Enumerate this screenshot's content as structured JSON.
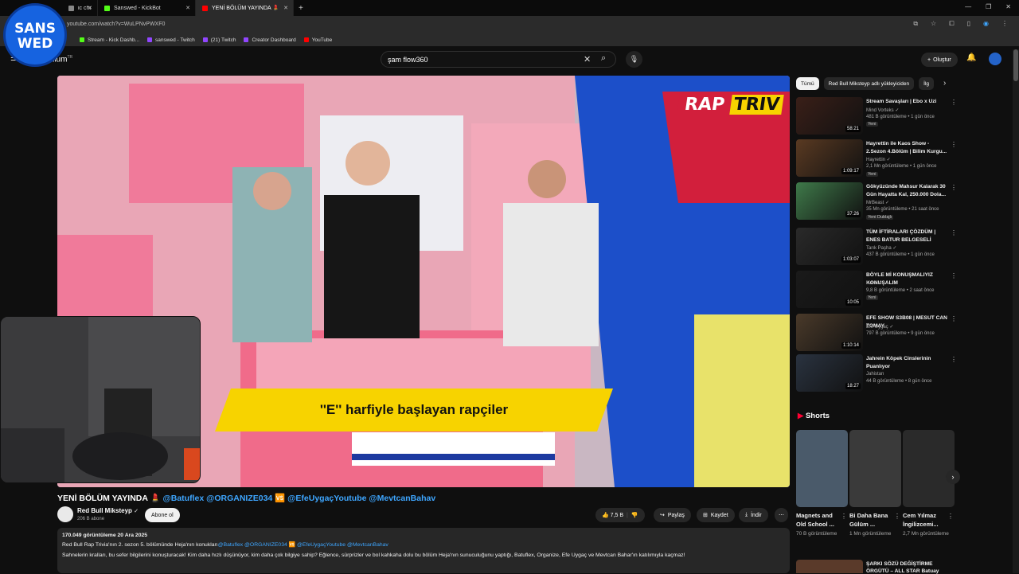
{
  "browser": {
    "tabs": [
      {
        "title": "ic charts: Nigeria",
        "color": "#888888"
      },
      {
        "title": "Sanswed - KickBot",
        "color": "#53fc18"
      },
      {
        "title": "YENİ BÖLÜM YAYINDA 💄",
        "color": "#ff0000",
        "active": true
      }
    ],
    "url": "youtube.com/watch?v=WuLPNvPWXF0",
    "bookmarks": [
      {
        "label": "Stream - Kick Dashb...",
        "color": "#53fc18"
      },
      {
        "label": "sanswed - Twitch",
        "color": "#9146ff"
      },
      {
        "label": "(21) Twitch",
        "color": "#9146ff"
      },
      {
        "label": "Creator Dashboard",
        "color": "#9146ff"
      },
      {
        "label": "YouTube",
        "color": "#ff0000"
      }
    ]
  },
  "overlay_logo": {
    "line1": "SANS",
    "line2": "WED"
  },
  "youtube": {
    "brand": "mium",
    "brand_suffix": "TR",
    "search_value": "şam flow360",
    "create_label": "Oluştur"
  },
  "video": {
    "caption": "''E'' harfiyle başlayan rapçiler",
    "title": "YENİ BÖLÜM YAYINDA 💄 ",
    "title_tags": "@Batuflex @ORGANIZE034 🆚 @EfeUygaçYoutube @MevtcanBahav",
    "channel": "Red Bull Miksteyp",
    "subscribers": "206 B abone",
    "subscribe_label": "Abone ol",
    "likes": "7,5 B",
    "share_label": "Paylaş",
    "save_label": "Kaydet",
    "download_label": "İndir",
    "views_date": "170.049 görüntüleme  20 Ara 2025",
    "desc_line1": "Red Bull Rap Trivia'nın 2. sezon 5. bölümünde Heja'nın konukları",
    "desc_line1_tags": "@Batuflex @ORGANIZE034 🆚 @EfeUygaçYoutube @MevtcanBahav",
    "desc_line2": "Sahnelerin kralları, bu sefer bilgilerini konuşturacak! Kim daha hızlı düşünüyor, kim daha çok bilgiye sahip? Eğlence, sürprizler ve bol kahkaha dolu bu bölüm Heja'nın sunuculuğunu yaptığı, Batuflex, Organize, Efe Uygaç ve Mevtcan Bahar'ın katılımıyla kaçmaz!"
  },
  "chips": [
    "Tümü",
    "Red Bull Miksteyp adlı yükleyiciden",
    "İlg"
  ],
  "recommendations": [
    {
      "title": "Stream Savaşları | Ebo x Uzi",
      "channel": "Mind Vorteks ✓",
      "meta": "481 B görüntüleme • 1 gün önce",
      "badge": "Yeni",
      "duration": "58:21",
      "color": "#3a1f18"
    },
    {
      "title": "Hayrettin ile Kaos Show - 2.Sezon 4.Bölüm | Bilim Kurgu...",
      "channel": "Hayrettin ✓",
      "meta": "2,1 Mn görüntüleme • 1 gün önce",
      "badge": "Yeni",
      "duration": "1:09:17",
      "color": "#5a3a22"
    },
    {
      "title": "Gökyüzünde Mahsur Kalarak 30 Gün Hayatta Kal, 250.000 Dola...",
      "channel": "MrBeast ✓",
      "meta": "35 Mn görüntüleme • 21 saat önce",
      "badge": "Yeni  Dublajlı",
      "duration": "37:26",
      "color": "#3f7a4a"
    },
    {
      "title": "TÜM İFTİRALARI ÇÖZDÜM | ENES BATUR BELGESELİ",
      "channel": "Tarık Paşha ✓",
      "meta": "437 B görüntüleme • 1 gün önce",
      "badge": "",
      "duration": "1:03:07",
      "color": "#2a2a2a"
    },
    {
      "title": "BÖYLE Mİ KONUŞMALIYIZ KONUŞALIM",
      "channel": "Harsuo",
      "meta": "9,8 B görüntüleme • 2 saat önce",
      "badge": "Yeni",
      "duration": "10:05",
      "color": "#1a1a1a"
    },
    {
      "title": "EFE SHOW S3B08 | MESUT CAN TOMAY",
      "channel": "Efe Uygaç ✓",
      "meta": "797 B görüntüleme • 9 gün önce",
      "badge": "",
      "duration": "1:10:14",
      "color": "#4a3a2a"
    },
    {
      "title": "Jahrein Köpek Cinslerinin Puanlıyor",
      "channel": "Jahistan",
      "meta": "44 B görüntüleme • 8 gün önce",
      "badge": "",
      "duration": "18:27",
      "color": "#2a3340"
    }
  ],
  "shorts": {
    "heading": "Shorts",
    "items": [
      {
        "title": "Magnets and Old School ...",
        "views": "70 B görüntüleme",
        "color": "#4a5a6a"
      },
      {
        "title": "Bi Daha Bana Gülüm ...",
        "views": "1 Mn görüntüleme",
        "color": "#3a3a3a"
      },
      {
        "title": "Cem Yılmaz İngilizcemi...",
        "views": "2,7 Mn görüntüleme",
        "color": "#2a2a2a"
      }
    ],
    "next_title": "ŞARKI SÖZÜ DEĞİŞTİRME ÖRGÜTÜ – ALL STAR Batuay"
  }
}
